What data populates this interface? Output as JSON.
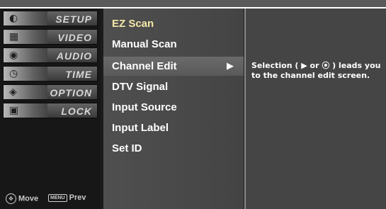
{
  "categories": [
    {
      "label": "SETUP",
      "icon": "satellite-dish-icon",
      "glyph": "◐"
    },
    {
      "label": "VIDEO",
      "icon": "film-reel-icon",
      "glyph": "▦"
    },
    {
      "label": "AUDIO",
      "icon": "speaker-icon",
      "glyph": "◉"
    },
    {
      "label": "TIME",
      "icon": "clock-icon",
      "glyph": "◷"
    },
    {
      "label": "OPTION",
      "icon": "option-badge-icon",
      "glyph": "◈"
    },
    {
      "label": "LOCK",
      "icon": "lock-icon",
      "glyph": "▣"
    }
  ],
  "help": {
    "move_label": "Move",
    "prev_label": "Prev",
    "menu_key_text": "MENU"
  },
  "submenu": {
    "items": [
      {
        "label": "EZ Scan"
      },
      {
        "label": "Manual Scan"
      },
      {
        "label": "Channel Edit",
        "arrow": "▶"
      },
      {
        "label": "DTV Signal"
      },
      {
        "label": "Input Source"
      },
      {
        "label": "Input Label"
      },
      {
        "label": "Set ID"
      }
    ]
  },
  "description": "Selection ( ▶ or ⦿ ) leads you to the channel edit screen."
}
